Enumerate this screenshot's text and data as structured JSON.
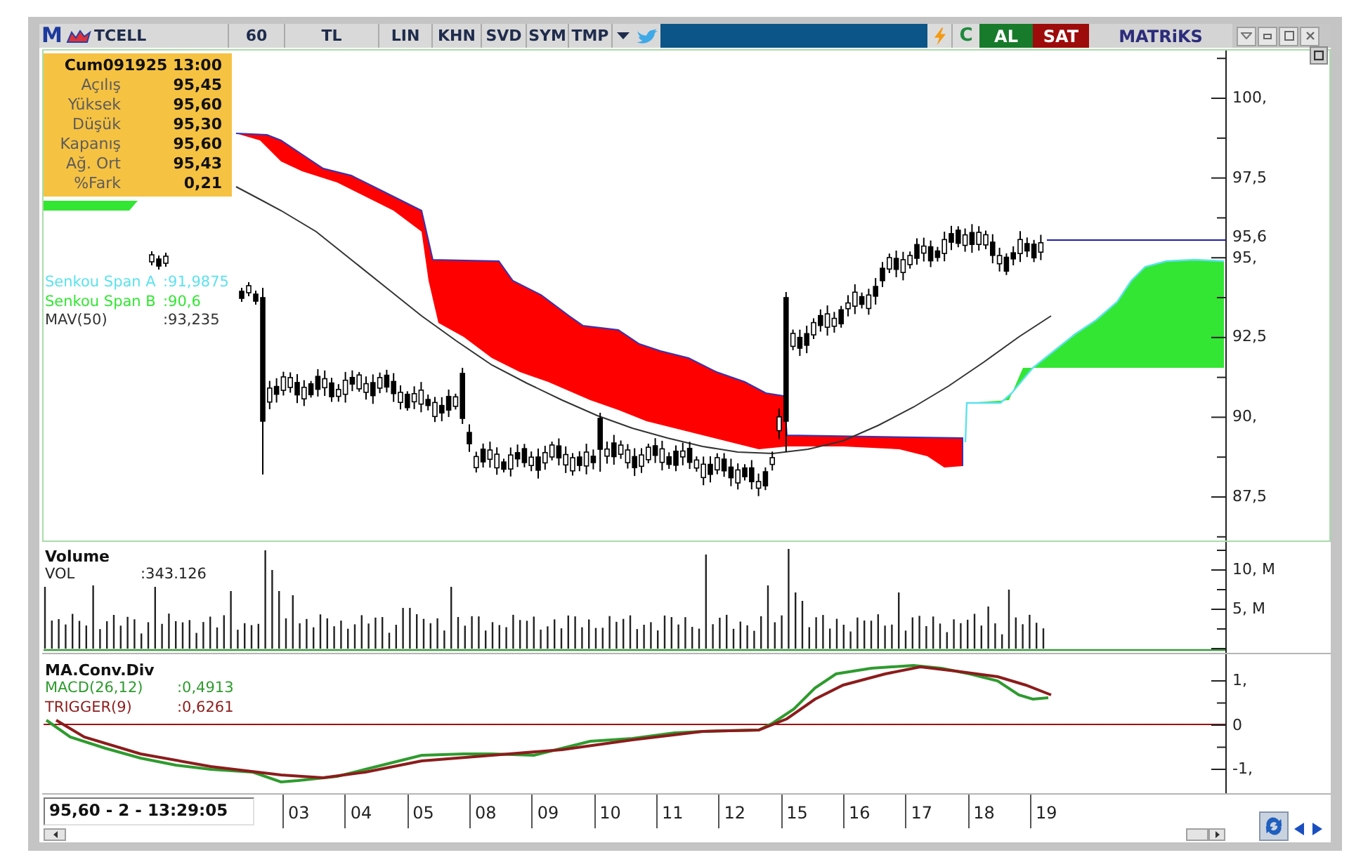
{
  "toolbar": {
    "logo": "M",
    "symbol": "TCELL",
    "period": "60",
    "currency": "TL",
    "tools": [
      "LIN",
      "KHN",
      "SVD",
      "SYM",
      "TMP"
    ],
    "refresh": "C",
    "buy": "AL",
    "sell": "SAT",
    "brand": "MATRiKS"
  },
  "info_box": {
    "title": "Cum091925 13:00",
    "rows": [
      {
        "label": "Açılış",
        "value": "95,45"
      },
      {
        "label": "Yüksek",
        "value": "95,60"
      },
      {
        "label": "Düşük",
        "value": "95,30"
      },
      {
        "label": "Kapanış",
        "value": "95,60"
      },
      {
        "label": "Ağ. Ort",
        "value": "95,43"
      },
      {
        "label": "%Fark",
        "value": "0,21"
      }
    ]
  },
  "price_panel": {
    "legend": [
      {
        "name": "Senkou Span A",
        "value": ":91,9875",
        "color": "#5ce2ee"
      },
      {
        "name": "Senkou Span B",
        "value": ":90,6",
        "color": "#33e633"
      },
      {
        "name": "MAV(50)",
        "value": ":93,235",
        "color": "#333333"
      }
    ],
    "axis_labels": [
      "100,",
      "97,5",
      "95,",
      "92,5",
      "90,",
      "87,5"
    ],
    "last_price": "95,6"
  },
  "volume_panel": {
    "title": "Volume",
    "legend": [
      {
        "name": "VOL",
        "value": ":343.126"
      }
    ],
    "axis_labels": [
      "10, M",
      "5, M"
    ]
  },
  "macd_panel": {
    "title": "MA.Conv.Div",
    "legend": [
      {
        "name": "MACD(26,12)",
        "value": ":0,4913",
        "color": "#2e9b2e"
      },
      {
        "name": "TRIGGER(9)",
        "value": ":0,6261",
        "color": "#8c1c1c"
      }
    ],
    "axis_labels": [
      "1,",
      "0",
      "-1,"
    ]
  },
  "time_axis": {
    "readout": "95,60 - 2 - 13:29:05",
    "dates": [
      "03",
      "04",
      "05",
      "08",
      "09",
      "10",
      "11",
      "12",
      "15",
      "16",
      "17",
      "18",
      "19"
    ]
  }
}
